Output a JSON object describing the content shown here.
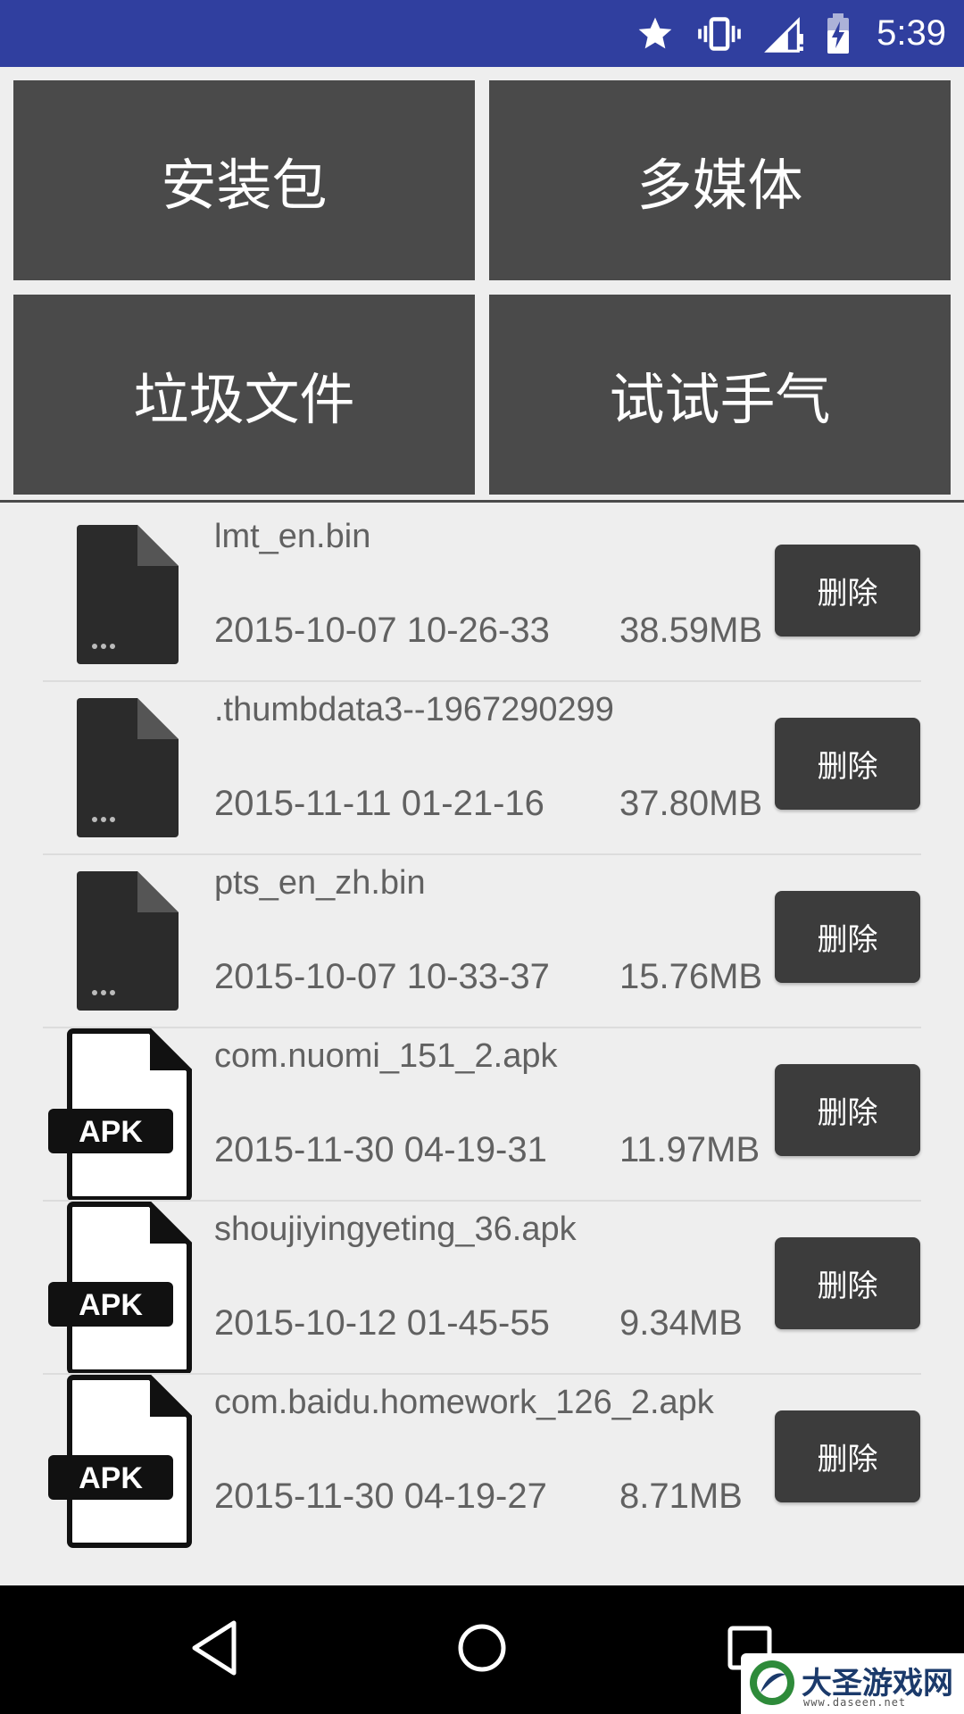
{
  "status_bar": {
    "time": "5:39",
    "icons": [
      "star-icon",
      "vibrate-icon",
      "signal-icon",
      "battery-charging-icon"
    ],
    "color": "#303f9f"
  },
  "categories": [
    {
      "label": "安装包"
    },
    {
      "label": "多媒体"
    },
    {
      "label": "垃圾文件"
    },
    {
      "label": "试试手气"
    }
  ],
  "files": [
    {
      "name": "lmt_en.bin",
      "date": "2015-10-07 10-26-33",
      "size": "38.59MB",
      "icon": "file-icon",
      "delete_label": "删除"
    },
    {
      "name": ".thumbdata3--1967290299",
      "date": "2015-11-11 01-21-16",
      "size": "37.80MB",
      "icon": "file-icon",
      "delete_label": "删除"
    },
    {
      "name": "pts_en_zh.bin",
      "date": "2015-10-07 10-33-37",
      "size": "15.76MB",
      "icon": "file-icon",
      "delete_label": "删除"
    },
    {
      "name": "com.nuomi_151_2.apk",
      "date": "2015-11-30 04-19-31",
      "size": "11.97MB",
      "icon": "apk-icon",
      "delete_label": "删除"
    },
    {
      "name": "shoujiyingyeting_36.apk",
      "date": "2015-10-12 01-45-55",
      "size": "9.34MB",
      "icon": "apk-icon",
      "delete_label": "删除"
    },
    {
      "name": "com.baidu.homework_126_2.apk",
      "date": "2015-11-30 04-19-27",
      "size": "8.71MB",
      "icon": "apk-icon",
      "delete_label": "删除"
    }
  ],
  "apk_badge": "APK",
  "nav_bar": {
    "icons": [
      "back-icon",
      "home-icon",
      "recents-icon"
    ]
  },
  "watermark": {
    "title": "大圣游戏网",
    "url": "www.daseen.net"
  }
}
